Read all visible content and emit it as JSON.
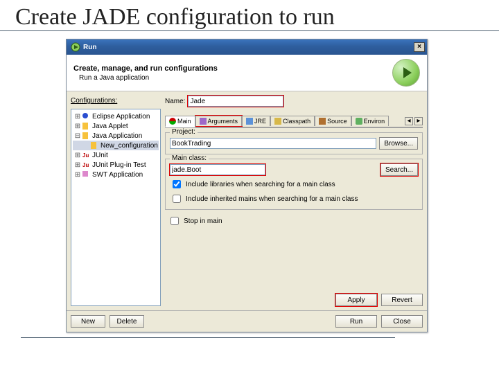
{
  "slide": {
    "title": "Create JADE configuration to run"
  },
  "dialog": {
    "title": "Run",
    "header": {
      "heading": "Create, manage, and run configurations",
      "sub": "Run a Java application"
    },
    "left": {
      "label": "Configurations:",
      "tree": [
        {
          "label": "Eclipse Application",
          "icon": "eclipse"
        },
        {
          "label": "Java Applet",
          "icon": "j"
        },
        {
          "label": "Java Application",
          "icon": "j",
          "expanded": true
        },
        {
          "label": "New_configuration",
          "icon": "j",
          "indent": true,
          "selected": true
        },
        {
          "label": "JUnit",
          "icon": "ju"
        },
        {
          "label": "JUnit Plug-in Test",
          "icon": "ju"
        },
        {
          "label": "SWT Application",
          "icon": "swt"
        }
      ]
    },
    "right": {
      "name_label": "Name:",
      "name_value": "Jade",
      "tabs": [
        {
          "label": "Main",
          "icon": "main",
          "active": true
        },
        {
          "label": "Arguments",
          "icon": "args"
        },
        {
          "label": "JRE",
          "icon": "jre"
        },
        {
          "label": "Classpath",
          "icon": "cp"
        },
        {
          "label": "Source",
          "icon": "src"
        },
        {
          "label": "Environ",
          "icon": "env"
        }
      ],
      "project": {
        "title": "Project:",
        "value": "BookTrading",
        "browse": "Browse..."
      },
      "mainclass": {
        "title": "Main class:",
        "value": "jade.Boot",
        "search": "Search...",
        "chk_incl_lib": "Include libraries when searching for a main class",
        "chk_incl_lib_checked": true,
        "chk_incl_inh": "Include inherited mains when searching for a main class",
        "chk_incl_inh_checked": false
      },
      "stop_in_main": {
        "label": "Stop in main",
        "checked": false
      }
    },
    "buttons": {
      "new": "New",
      "delete": "Delete",
      "apply": "Apply",
      "revert": "Revert",
      "run": "Run",
      "close": "Close"
    }
  }
}
